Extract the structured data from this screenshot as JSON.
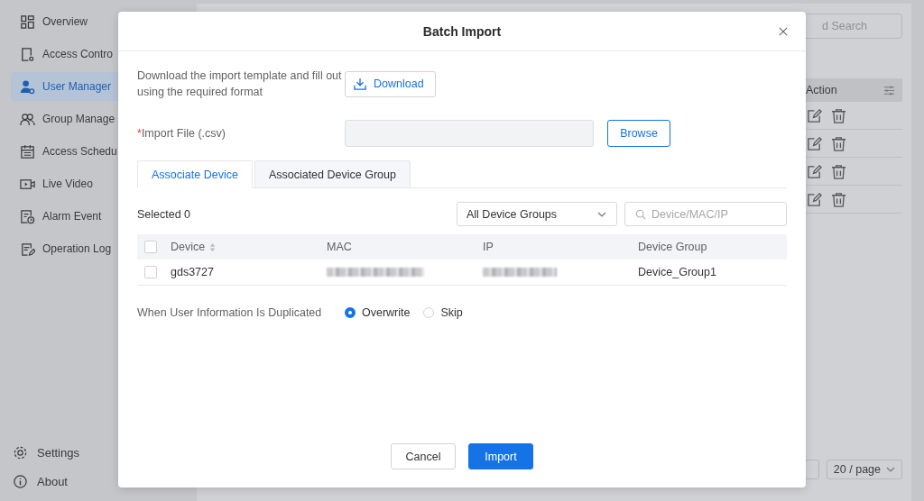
{
  "sidebar": {
    "items": [
      {
        "label": "Overview",
        "selected": false
      },
      {
        "label": "Access Contro",
        "selected": false
      },
      {
        "label": "User Manager",
        "selected": true
      },
      {
        "label": "Group Manage",
        "selected": false
      },
      {
        "label": "Access Schedu",
        "selected": false
      },
      {
        "label": "Live Video",
        "selected": false
      },
      {
        "label": "Alarm Event",
        "selected": false
      },
      {
        "label": "Operation Log",
        "selected": false
      }
    ],
    "footer": [
      {
        "label": "Settings"
      },
      {
        "label": "About"
      }
    ]
  },
  "background": {
    "search_text": "d Search",
    "action_header": "Action",
    "page_size": "20 / page"
  },
  "dialog": {
    "title": "Batch Import",
    "template_hint": "Download the import template and fill out using the required format",
    "download_button": "Download",
    "import_file": {
      "required_mark": "*",
      "label": "Import File (.csv)",
      "browse_button": "Browse"
    },
    "tabs": [
      {
        "label": "Associate Device",
        "selected": true
      },
      {
        "label": "Associated Device Group",
        "selected": false
      }
    ],
    "selected_count": "Selected 0",
    "group_filter": {
      "value": "All Device Groups"
    },
    "search": {
      "placeholder": "Device/MAC/IP"
    },
    "table": {
      "select_all_checked": false,
      "columns": [
        {
          "label": "Device",
          "sortable": true
        },
        {
          "label": "MAC",
          "sortable": false
        },
        {
          "label": "IP",
          "sortable": false
        },
        {
          "label": "Device Group",
          "sortable": false
        }
      ],
      "rows": [
        {
          "checked": false,
          "device": "gds3727",
          "device_group": "Device_Group1"
        }
      ]
    },
    "duplicate": {
      "label": "When User Information Is Duplicated",
      "options": [
        {
          "label": "Overwrite",
          "selected": true
        },
        {
          "label": "Skip",
          "selected": false
        }
      ]
    },
    "buttons": {
      "cancel": "Cancel",
      "import": "Import"
    }
  }
}
